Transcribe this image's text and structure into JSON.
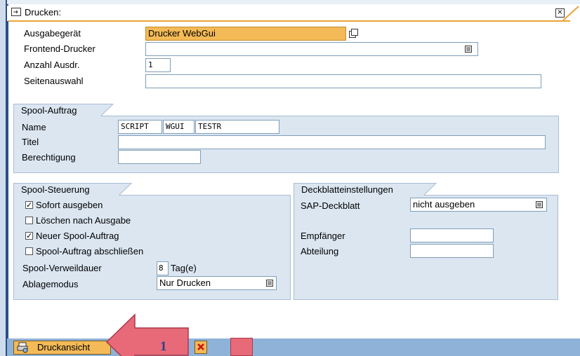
{
  "dialog": {
    "title": "Drucken:",
    "close_glyph": "×"
  },
  "form": {
    "output_device": {
      "label": "Ausgabegerät",
      "value": "Drucker WebGui"
    },
    "frontend_printer": {
      "label": "Frontend-Drucker",
      "value": ""
    },
    "copies": {
      "label": "Anzahl Ausdr.",
      "value": "1"
    },
    "page_selection": {
      "label": "Seitenauswahl",
      "value": ""
    }
  },
  "spool_request": {
    "title": "Spool-Auftrag",
    "name": {
      "label": "Name",
      "values": [
        "SCRIPT",
        "WGUI",
        "TESTR"
      ]
    },
    "title_field": {
      "label": "Titel",
      "value": ""
    },
    "authorization": {
      "label": "Berechtigung",
      "value": ""
    }
  },
  "spool_control": {
    "title": "Spool-Steuerung",
    "checkboxes": [
      {
        "label": "Sofort ausgeben",
        "checked": true
      },
      {
        "label": "Löschen nach Ausgabe",
        "checked": false
      },
      {
        "label": "Neuer Spool-Auftrag",
        "checked": true
      },
      {
        "label": "Spool-Auftrag abschließen",
        "checked": false
      }
    ],
    "retention": {
      "label": "Spool-Verweildauer",
      "value": "8",
      "unit": "Tag(e)"
    },
    "storage_mode": {
      "label": "Ablagemodus",
      "value": "Nur Drucken"
    }
  },
  "cover_settings": {
    "title": "Deckblatteinstellungen",
    "sap_cover": {
      "label": "SAP-Deckblatt",
      "value": "nicht ausgeben"
    },
    "recipient": {
      "label": "Empfänger",
      "value": ""
    },
    "department": {
      "label": "Abteilung",
      "value": ""
    }
  },
  "footer": {
    "print_preview_label": "Druckansicht",
    "annotation_number": "1"
  },
  "colors": {
    "highlight_field": "#f3ba57",
    "group_bg": "#dbe6f1",
    "bottom_bar": "#8fb2d9",
    "annotation_arrow": "#e86a78"
  }
}
